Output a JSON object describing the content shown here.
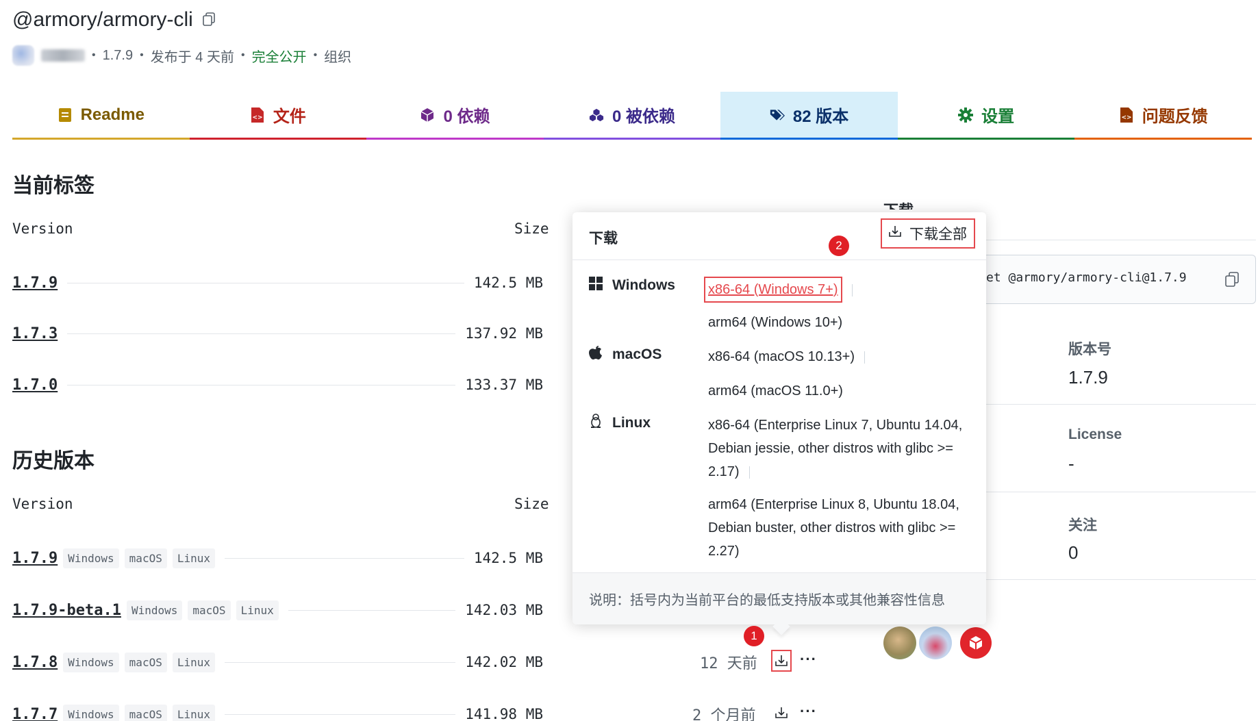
{
  "package": {
    "name": "@armory/armory-cli",
    "version": "1.7.9",
    "published": "发布于 4 天前",
    "visibility": "完全公开",
    "scope": "组织"
  },
  "tabs": [
    {
      "label": "Readme",
      "color": "#d4a72c",
      "text_color": "#7a5a00",
      "icon": "book-icon"
    },
    {
      "label": "文件",
      "color": "#cf222e",
      "text_color": "#b42318",
      "icon": "file-code-icon"
    },
    {
      "label": "0 依赖",
      "color": "#bf39c9",
      "text_color": "#6e2a8a",
      "icon": "cube-icon"
    },
    {
      "label": "0 被依赖",
      "color": "#8250df",
      "text_color": "#3b2a8a",
      "icon": "cubes-icon"
    },
    {
      "label": "82 版本",
      "color": "#0969da",
      "text_color": "#0a3069",
      "icon": "tags-icon",
      "active": true
    },
    {
      "label": "设置",
      "color": "#1a7f37",
      "text_color": "#1a7f37",
      "icon": "gear-icon"
    },
    {
      "label": "问题反馈",
      "color": "#e36209",
      "text_color": "#953800",
      "icon": "issue-icon"
    }
  ],
  "current_tags": {
    "heading": "当前标签",
    "col_version": "Version",
    "col_size": "Size",
    "rows": [
      {
        "version": "1.7.9",
        "size": "142.5 MB"
      },
      {
        "version": "1.7.3",
        "size": "137.92 MB"
      },
      {
        "version": "1.7.0",
        "size": "133.37 MB"
      }
    ]
  },
  "history": {
    "heading": "历史版本",
    "col_version": "Version",
    "col_size": "Size",
    "rows": [
      {
        "version": "1.7.9",
        "badges": [
          "Windows",
          "macOS",
          "Linux"
        ],
        "size": "142.5 MB",
        "time": ""
      },
      {
        "version": "1.7.9-beta.1",
        "badges": [
          "Windows",
          "macOS",
          "Linux"
        ],
        "size": "142.03 MB",
        "time": ""
      },
      {
        "version": "1.7.8",
        "badges": [
          "Windows",
          "macOS",
          "Linux"
        ],
        "size": "142.02 MB",
        "time": "12 天前"
      },
      {
        "version": "1.7.7",
        "badges": [
          "Windows",
          "macOS",
          "Linux"
        ],
        "size": "141.98 MB",
        "time": "2 个月前"
      }
    ]
  },
  "popup": {
    "title": "下载",
    "download_all": "下载全部",
    "windows": {
      "label": "Windows",
      "options": [
        "x86-64 (Windows 7+)",
        "arm64 (Windows 10+)"
      ]
    },
    "macos": {
      "label": "macOS",
      "options": [
        "x86-64 (macOS 10.13+)",
        "arm64 (macOS 11.0+)"
      ]
    },
    "linux": {
      "label": "Linux",
      "options": [
        "x86-64 (Enterprise Linux 7, Ubuntu 14.04, Debian jessie, other distros with glibc >= 2.17)",
        "arm64 (Enterprise Linux 8, Ubuntu 18.04, Debian buster, other distros with glibc >= 2.27)"
      ]
    },
    "note": "说明：括号内为当前平台的最低支持版本或其他兼容性信息"
  },
  "annotations": {
    "marker1": "1",
    "marker2": "2"
  },
  "sidebar": {
    "partial_heading": "下载",
    "command": "et @armory/armory-cli@1.7.9",
    "version_label": "版本号",
    "version_value": "1.7.9",
    "license_label": "License",
    "license_value": "-",
    "follow_label": "关注",
    "follow_value": "0"
  }
}
